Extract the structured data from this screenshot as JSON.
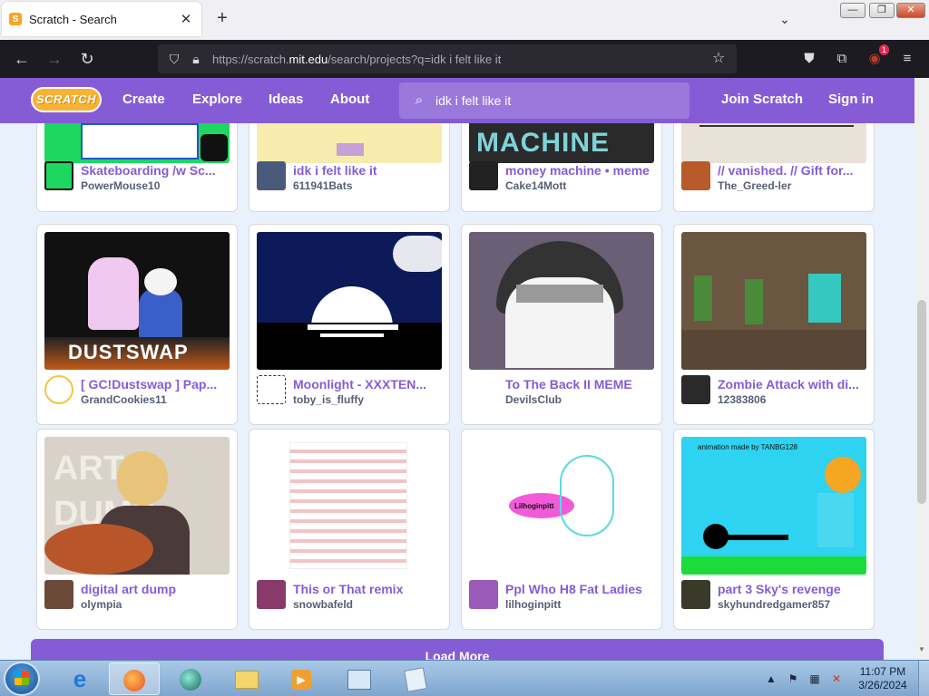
{
  "browser": {
    "tab_title": "Scratch - Search",
    "tab_close": "✕",
    "new_tab": "+",
    "url_host_prefix": "https://scratch.",
    "url_host": "mit.edu",
    "url_path": "/search/projects?q=idk i felt like it",
    "extension_badge": "1"
  },
  "header": {
    "logo_text": "SCRATCH",
    "nav": [
      "Create",
      "Explore",
      "Ideas",
      "About"
    ],
    "search_value": "idk i felt like it",
    "join": "Join Scratch",
    "signin": "Sign in"
  },
  "projects": [
    {
      "title": "Skateboarding /w Sc...",
      "author": "PowerMouse10",
      "thumb_color": "#1ed760",
      "avatar_color": "#1a1a1a"
    },
    {
      "title": "idk i felt like it",
      "author": "611941Bats",
      "thumb_color": "#f7ecae",
      "avatar_color": "#4a5a7a"
    },
    {
      "title": "money machine • meme",
      "author": "Cake14Mott",
      "thumb_color": "#3a3a3a",
      "avatar_color": "#222222"
    },
    {
      "title": "// vanished. // Gift for...",
      "author": "The_Greed-ler",
      "thumb_color": "#e9e2d8",
      "avatar_color": "#b85a2a"
    },
    {
      "title": "[ GC!Dustswap ] Pap...",
      "author": "GrandCookies11",
      "thumb_color": "#111111",
      "avatar_color": "#f5c542"
    },
    {
      "title": "Moonlight - XXXTEN...",
      "author": "toby_is_fluffy",
      "thumb_color": "#0d1a5a",
      "avatar_color": "#ffffff"
    },
    {
      "title": "To The Back II MEME",
      "author": "DevilsClub",
      "thumb_color": "#6a5f74",
      "avatar_color": "#ffffff"
    },
    {
      "title": "Zombie Attack with di...",
      "author": "12383806",
      "thumb_color": "#6b5642",
      "avatar_color": "#2a2a2a"
    },
    {
      "title": "digital art dump",
      "author": "olympia",
      "thumb_color": "#d9d2c8",
      "avatar_color": "#6b4a3a"
    },
    {
      "title": "This or That remix",
      "author": "snowbafeld",
      "thumb_color": "#ffffff",
      "avatar_color": "#8a3a6a"
    },
    {
      "title": "Ppl Who H8 Fat Ladies",
      "author": "lilhoginpitt",
      "thumb_color": "#ffffff",
      "avatar_color": "#9a5ab8"
    },
    {
      "title": "part 3 Sky's revenge",
      "author": "skyhundredgamer857",
      "thumb_color": "#2fd3f2",
      "avatar_color": "#3a3a2a"
    }
  ],
  "thumb_texts": {
    "machine": "MACHINE",
    "dustswap": "DUSTSWAP",
    "artdump": "ART DUMP",
    "lilhog": "Lilhoginpitt",
    "animation": "animation made by TANBG128"
  },
  "load_more": "Load More",
  "taskbar": {
    "time": "11:07 PM",
    "date": "3/26/2024"
  }
}
